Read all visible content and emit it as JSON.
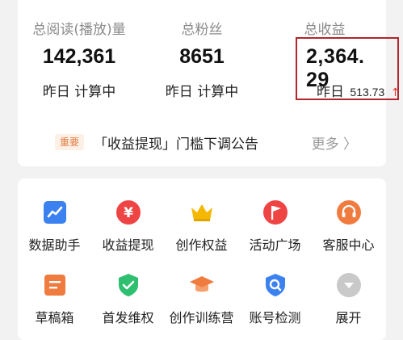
{
  "stats": {
    "reads": {
      "label": "总阅读(播放)量",
      "value": "142,361",
      "sub": "昨日 计算中"
    },
    "fans": {
      "label": "总粉丝",
      "value": "8651",
      "sub": "昨日 计算中"
    },
    "earnings": {
      "label": "总收益",
      "value": "2,364. 29",
      "sub_prefix": "昨日",
      "sub_amount": "513.73",
      "trend_icon": "arrow-up",
      "trend_color": "#e23b3b"
    }
  },
  "notice": {
    "tag": "重要",
    "text": "「收益提现」门槛下调公告",
    "more": "更多 〉"
  },
  "tools": [
    {
      "label": "数据助手",
      "icon": "chart-icon",
      "color": "#3b82f0"
    },
    {
      "label": "收益提现",
      "icon": "yen-icon",
      "color": "#ef4444"
    },
    {
      "label": "创作权益",
      "icon": "crown-icon",
      "color": "#f5b800"
    },
    {
      "label": "活动广场",
      "icon": "flag-icon",
      "color": "#ef4444"
    },
    {
      "label": "客服中心",
      "icon": "headset-icon",
      "color": "#f07b3f"
    },
    {
      "label": "草稿箱",
      "icon": "document-icon",
      "color": "#f07b3f"
    },
    {
      "label": "首发维权",
      "icon": "shield-icon",
      "color": "#2fbf71"
    },
    {
      "label": "创作训练营",
      "icon": "graduation-cap-icon",
      "color": "#f07b3f"
    },
    {
      "label": "账号检测",
      "icon": "search-icon",
      "color": "#3b82f0"
    },
    {
      "label": "展开",
      "icon": "chevron-down-icon",
      "color": "#c9c9c9"
    }
  ],
  "colors": {
    "highlight_border": "#b2262c",
    "notice_tag_bg": "#fdf0e6",
    "notice_tag_text": "#e37b3e"
  }
}
